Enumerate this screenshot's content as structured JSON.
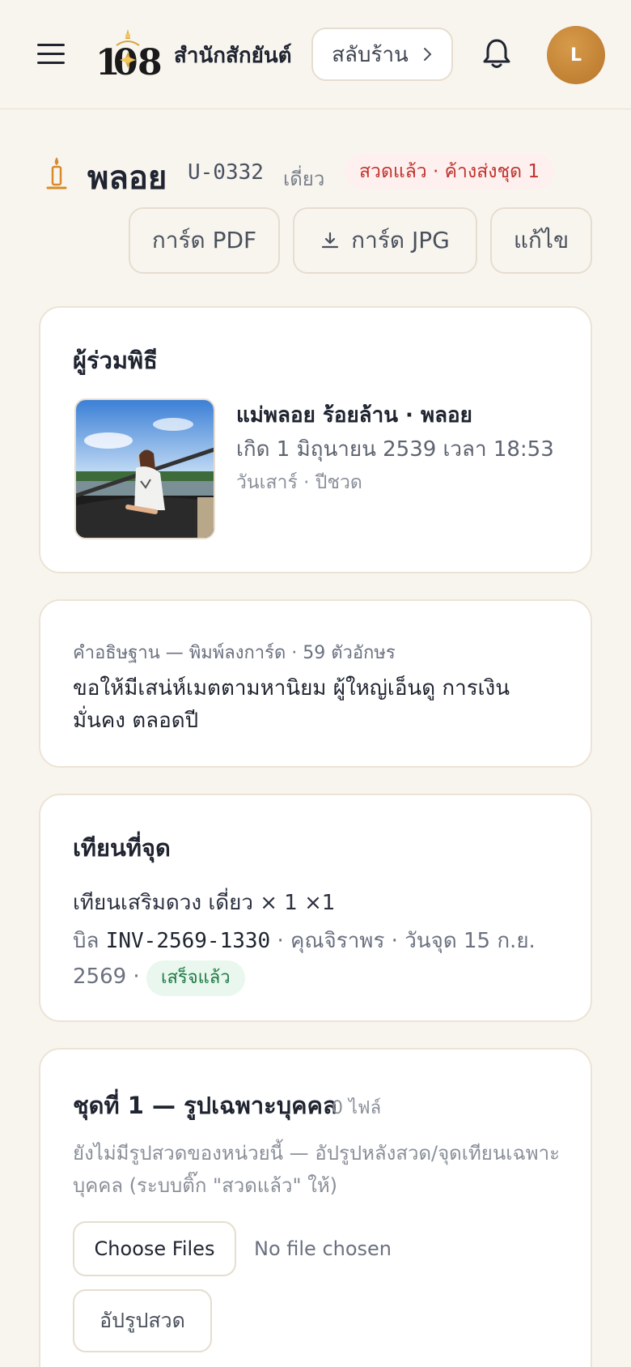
{
  "header": {
    "logo_text": "108",
    "shop_name": "สำนักสักยันต์",
    "switch_label": "สลับร้าน",
    "avatar_initial": "L"
  },
  "unit": {
    "name": "พลอย",
    "code": "U-0332",
    "type": "เดี่ยว",
    "status": "สวดแล้ว · ค้างส่งชุด 1"
  },
  "actions": {
    "pdf_label": "การ์ด PDF",
    "jpg_label": "การ์ด JPG",
    "edit_label": "แก้ไข"
  },
  "participant": {
    "section_title": "ผู้ร่วมพิธี",
    "full_name": "แม่พลอย ร้อยล้าน · พลอย",
    "birth": "เกิด 1 มิถุนายน 2539 เวลา 18:53",
    "day_year": "วันเสาร์ · ปีชวด"
  },
  "wish": {
    "label": "คำอธิษฐาน — พิมพ์ลงการ์ด · 59 ตัวอักษร",
    "text": "ขอให้มีเสน่ห์เมตตามหานิยม ผู้ใหญ่เอ็นดู การเงินมั่นคง ตลอดปี"
  },
  "candles": {
    "section_title": "เทียนที่จุด",
    "item": "เทียนเสริมดวง เดี่ยว × 1 ×1",
    "bill_prefix": "บิล",
    "bill_no": "INV-2569-1330",
    "bill_suffix": "· คุณจิราพร · วันจุด 15 ก.ย. 2569 ·",
    "bill_status": "เสร็จแล้ว"
  },
  "set1": {
    "title": "ชุดที่ 1 — รูปเฉพาะบุคคล",
    "file_count": "0 ไฟล์",
    "description": "ยังไม่มีรูปสวดของหน่วยนี้ — อัปรูปหลังสวด/จุดเทียนเฉพาะบุคคล (ระบบติ๊ก \"สวดแล้ว\" ให้)",
    "choose_files": "Choose Files",
    "no_file": "No file chosen",
    "upload_label": "อัปรูปสวด"
  },
  "colors": {
    "background": "#f8f5ef",
    "accent_gold": "#c9893a",
    "status_red": "#c0332d",
    "success_green": "#1f7a45"
  }
}
